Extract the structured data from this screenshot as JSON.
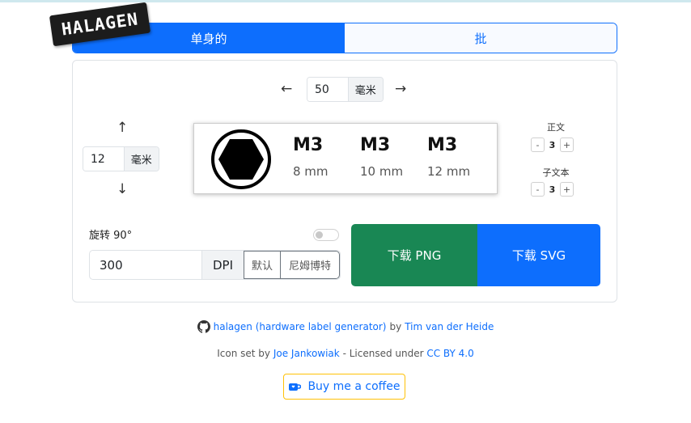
{
  "logo": {
    "text": "HALAGEN"
  },
  "tabs": [
    {
      "label": "单身的",
      "active": true
    },
    {
      "label": "批",
      "active": false
    }
  ],
  "width_control": {
    "left_arrow": "←",
    "value": "50",
    "unit": "毫米",
    "right_arrow": "→"
  },
  "height_control": {
    "up_arrow": "↑",
    "value": "12",
    "unit": "毫米",
    "down_arrow": "↓"
  },
  "label_preview": {
    "icon": "hex-socket-icon",
    "specs": [
      {
        "size": "M3",
        "length": "8 mm"
      },
      {
        "size": "M3",
        "length": "10 mm"
      },
      {
        "size": "M3",
        "length": "12 mm"
      }
    ]
  },
  "text_size": {
    "body_label": "正文",
    "body_value": "3",
    "sub_label": "子文本",
    "sub_value": "3",
    "minus": "-",
    "plus": "+"
  },
  "rotate": {
    "label": "旋转 90°",
    "enabled": false
  },
  "dpi": {
    "value": "300",
    "unit": "DPI",
    "preset_default": "默认",
    "preset_2": "尼姆博特"
  },
  "download": {
    "png": "下载 PNG",
    "svg": "下载 SVG"
  },
  "footer": {
    "github_icon": "github-icon",
    "project_link": "halagen (hardware label generator)",
    "by_text": "by",
    "author_link": "Tim van der Heide",
    "icon_set_text": "Icon set by",
    "icon_author_link": "Joe Jankowiak",
    "licensed_text": "- Licensed under",
    "license_link": "CC BY 4.0"
  },
  "coffee": {
    "icon": "coffee-cup-icon",
    "label": "Buy me a coffee"
  },
  "colors": {
    "primary": "#0d6efd",
    "success": "#198754",
    "coffee_border": "#ffc107"
  }
}
